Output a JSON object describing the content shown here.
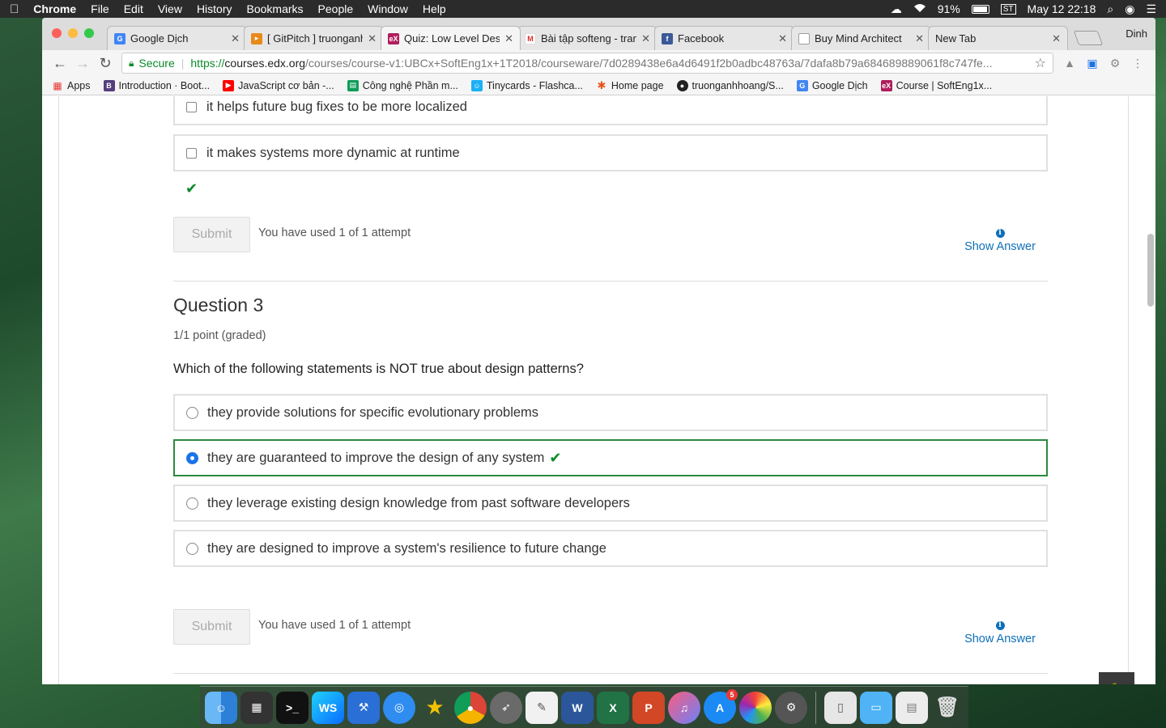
{
  "menubar": {
    "apple": "",
    "app": "Chrome",
    "menus": [
      "File",
      "Edit",
      "View",
      "History",
      "Bookmarks",
      "People",
      "Window",
      "Help"
    ],
    "battery": "91%",
    "datetime": "May 12  22:18"
  },
  "browser": {
    "profile": "Dinh",
    "tabs": [
      {
        "title": "Google Dịch",
        "icon": "google-translate-icon",
        "color": "#4285f4"
      },
      {
        "title": "[ GitPitch ] truonganh",
        "icon": "gitpitch-icon",
        "color": "#e88a1a"
      },
      {
        "title": "Quiz: Low Level Desi",
        "icon": "edx-icon",
        "color": "#b01e5c"
      },
      {
        "title": "Bài tập softeng - tran",
        "icon": "gmail-icon",
        "color": "#d93025"
      },
      {
        "title": "Facebook",
        "icon": "facebook-icon",
        "color": "#3b5998"
      },
      {
        "title": "Buy Mind Architect",
        "icon": "page-icon",
        "color": "#9e9e9e"
      },
      {
        "title": "New Tab",
        "icon": "",
        "color": ""
      }
    ],
    "active_tab": 2,
    "secure_label": "Secure",
    "url": {
      "scheme": "https://",
      "host": "courses.edx.org",
      "path": "/courses/course-v1:UBCx+SoftEng1x+1T2018/courseware/7d0289438e6a4d6491f2b0adbc48763a/7dafa8b79a684689889061f8c747fe..."
    },
    "bookmarks": [
      {
        "label": "Apps",
        "icon": "apps-grid-icon",
        "color": "#e53935"
      },
      {
        "label": "Introduction · Boot...",
        "icon": "bootstrap-icon",
        "color": "#563d7c"
      },
      {
        "label": "JavaScript cơ bản -...",
        "icon": "youtube-icon",
        "color": "#ff0000"
      },
      {
        "label": "Công nghệ Phần m...",
        "icon": "sheets-icon",
        "color": "#0f9d58"
      },
      {
        "label": "Tinycards - Flashca...",
        "icon": "tinycards-icon",
        "color": "#1cb0f6"
      },
      {
        "label": "Home page",
        "icon": "asterisk-icon",
        "color": "#e8541a"
      },
      {
        "label": "truonganhhoang/S...",
        "icon": "github-icon",
        "color": "#222222"
      },
      {
        "label": "Google Dịch",
        "icon": "google-translate-icon",
        "color": "#4285f4"
      },
      {
        "label": "Course | SoftEng1x...",
        "icon": "edx-icon",
        "color": "#b01e5c"
      }
    ]
  },
  "question2": {
    "options": [
      {
        "label": "it helps future bug fixes to be more localized",
        "checked": false
      },
      {
        "label": "it makes systems more dynamic at runtime",
        "checked": false
      }
    ],
    "status_icon": "checkmark-icon",
    "submit_label": "Submit",
    "attempts": "You have used 1 of 1 attempt",
    "show_answer": "Show Answer"
  },
  "question3": {
    "title": "Question 3",
    "points": "1/1 point (graded)",
    "prompt": "Which of the following statements is NOT true about design patterns?",
    "options": [
      {
        "label": "they provide solutions for specific evolutionary problems",
        "selected": false
      },
      {
        "label": "they are guaranteed to improve the design of any system",
        "selected": true,
        "correct": true
      },
      {
        "label": "they leverage existing design knowledge from past software developers",
        "selected": false
      },
      {
        "label": "they are designed to improve a system's resilience to future change",
        "selected": false
      }
    ],
    "submit_label": "Submit",
    "attempts": "You have used 1 of 1 attempt",
    "show_answer": "Show Answer"
  },
  "dock": {
    "app_store_badge": "5"
  },
  "colors": {
    "correct": "#2b8a3e",
    "link": "#0d6fb8",
    "selected_radio": "#1a73e8"
  }
}
